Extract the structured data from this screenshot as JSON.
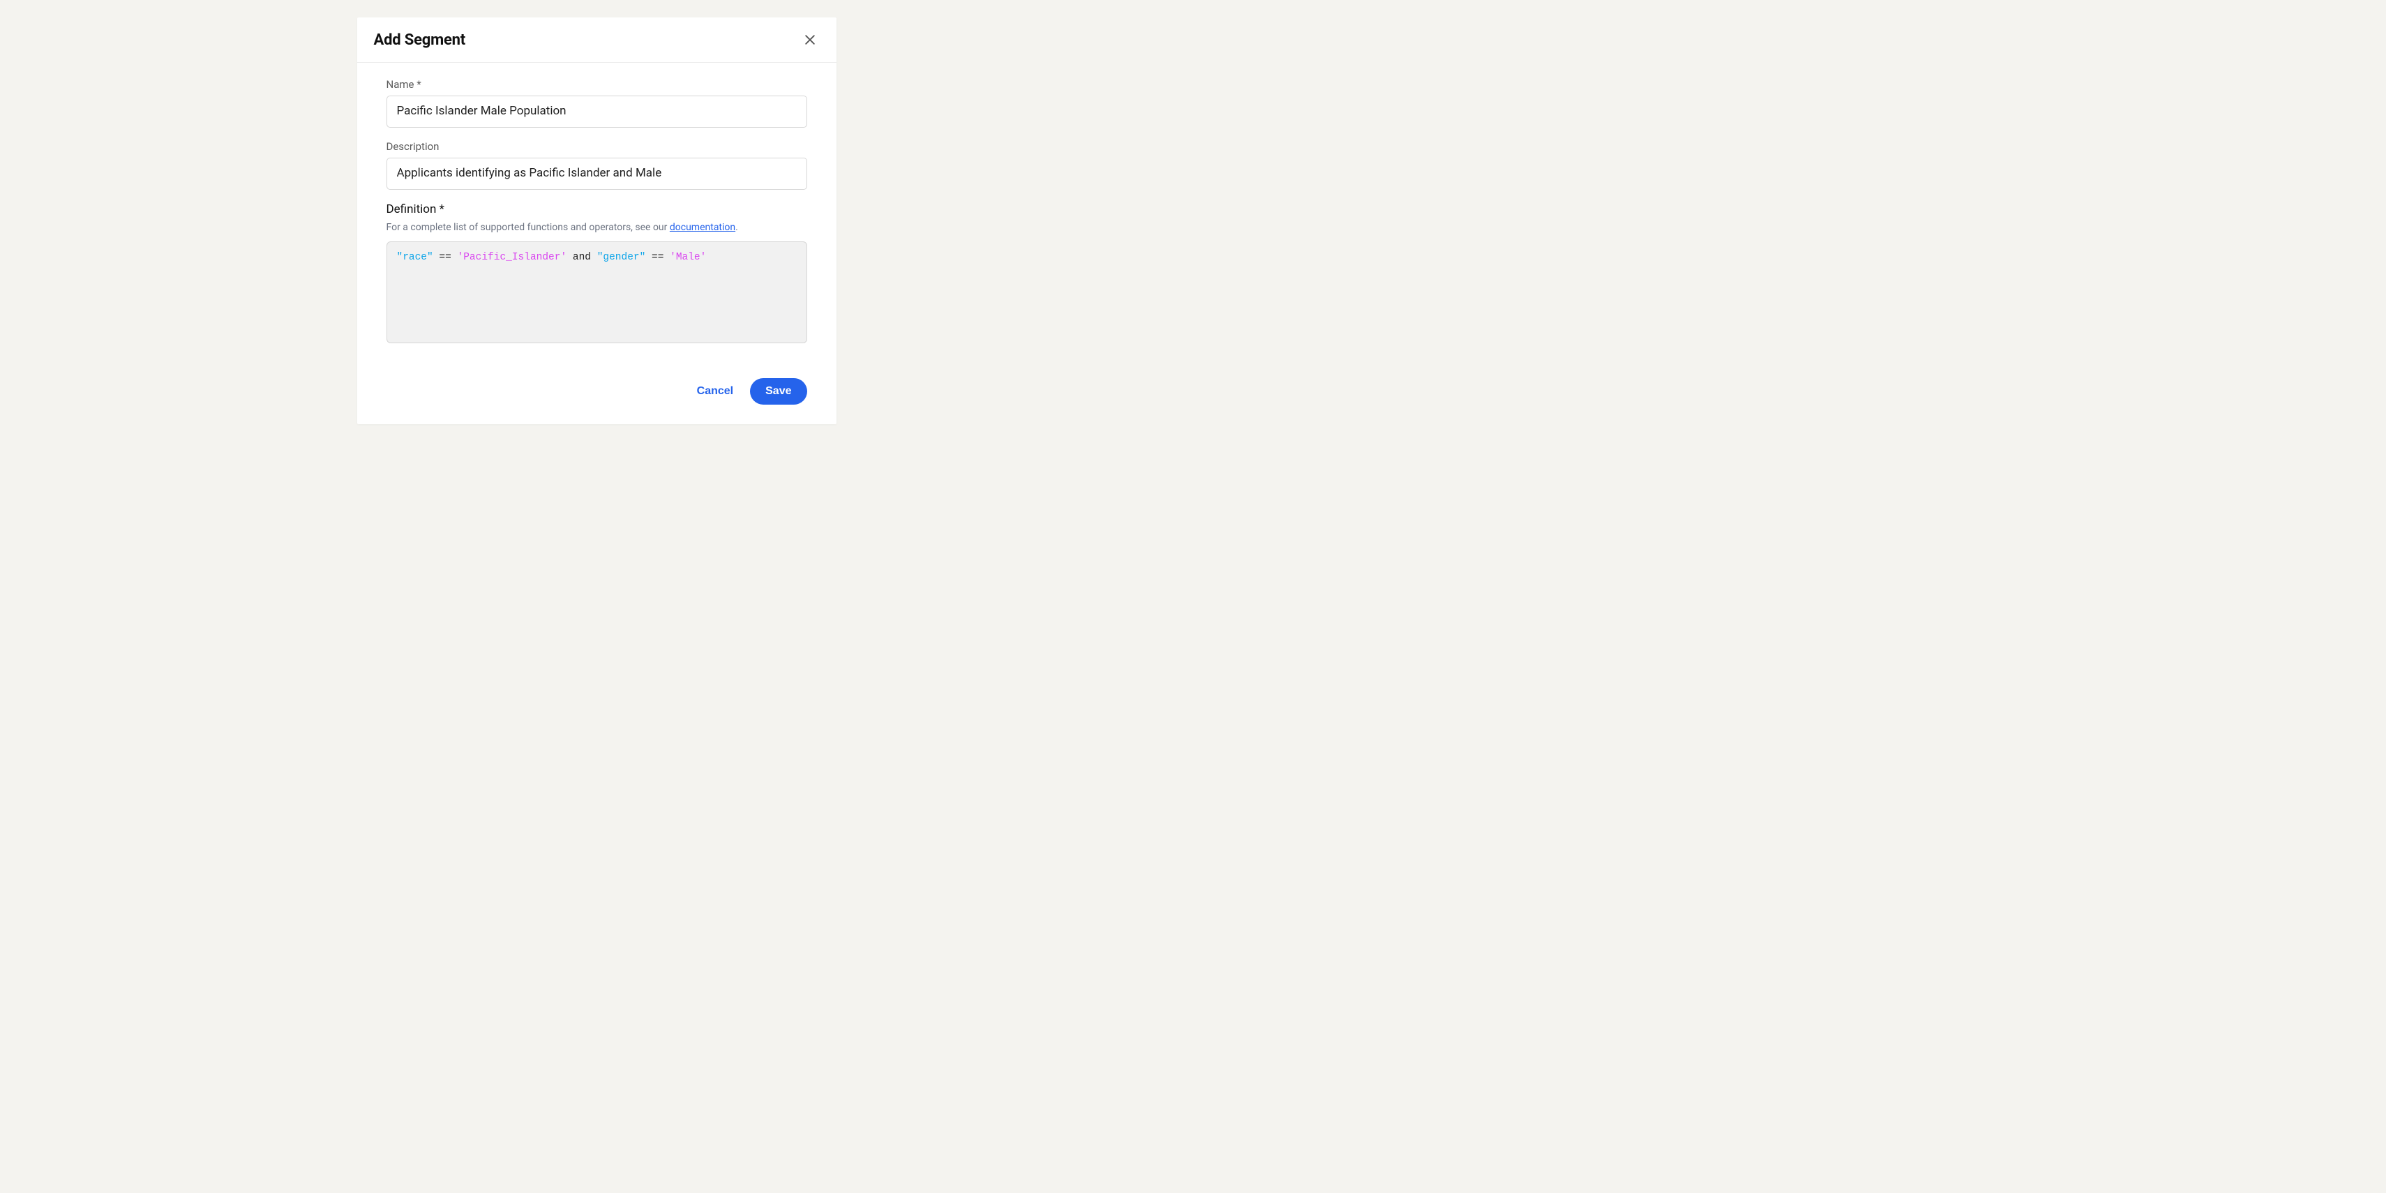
{
  "modal": {
    "title": "Add Segment",
    "fields": {
      "name": {
        "label": "Name *",
        "value": "Pacific Islander Male Population"
      },
      "description": {
        "label": "Description",
        "value": "Applicants identifying as Pacific Islander and Male"
      },
      "definition": {
        "label": "Definition *",
        "help_prefix": "For a complete list of supported functions and operators, see our ",
        "help_link_text": "documentation",
        "help_suffix": ".",
        "tokens": {
          "field1": "\"race\"",
          "op1": " == ",
          "str1": "'Pacific_Islander'",
          "kw1": " and ",
          "field2": "\"gender\"",
          "op2": " == ",
          "str2": "'Male'"
        }
      }
    },
    "buttons": {
      "cancel": "Cancel",
      "save": "Save"
    }
  }
}
